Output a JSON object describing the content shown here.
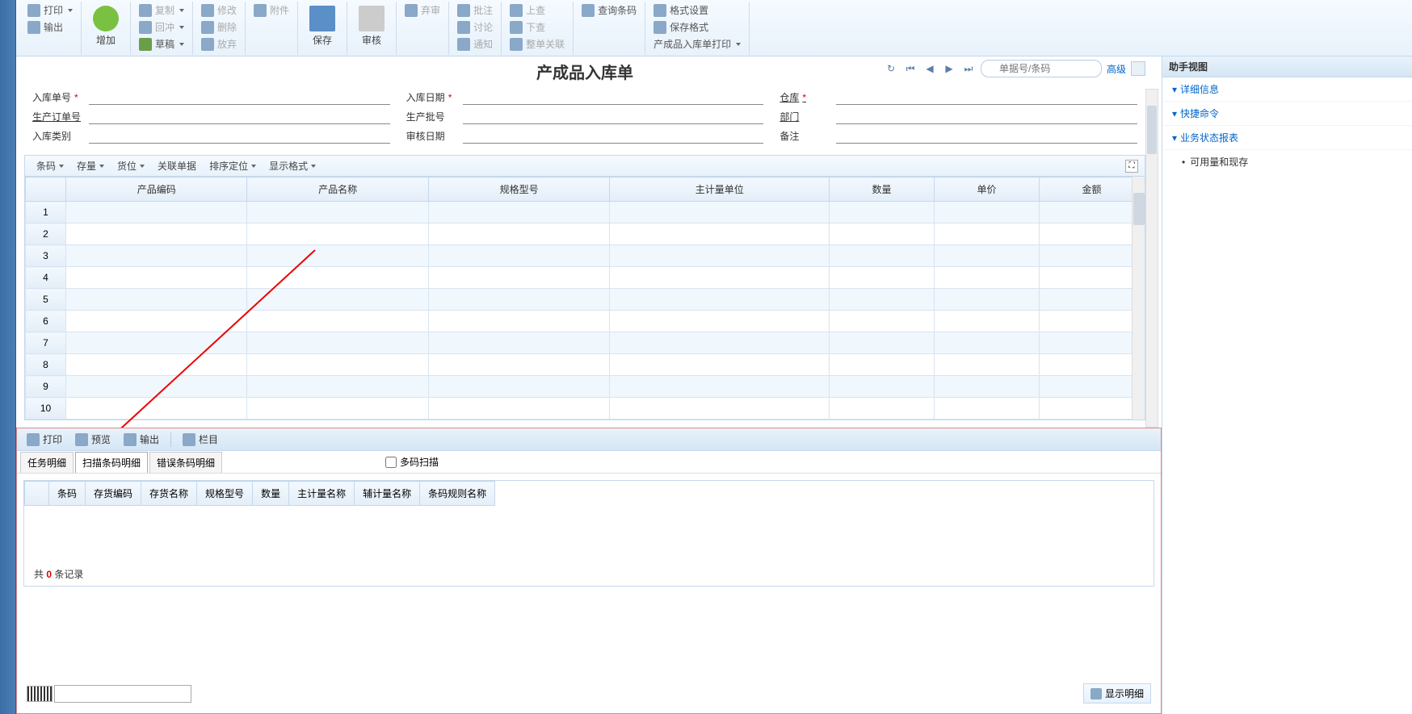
{
  "ribbon": {
    "print": "打印",
    "export": "输出",
    "add": "增加",
    "copy": "复制",
    "undo": "回冲",
    "draft": "草稿",
    "modify": "修改",
    "delete": "删除",
    "attach": "附件",
    "abandon": "放弃",
    "save": "保存",
    "audit": "审核",
    "reject": "弃审",
    "approve": "批注",
    "discuss": "讨论",
    "notify": "通知",
    "submit": "上查",
    "lookup": "下查",
    "wholeLink": "整单关联",
    "queryBarcode": "查询条码",
    "formatSet": "格式设置",
    "saveFormat": "保存格式",
    "printDoc": "产成品入库单打印"
  },
  "doc": {
    "title": "产成品入库单",
    "searchPlaceholder": "单据号/条码",
    "advanced": "高级"
  },
  "form": {
    "billNo": "入库单号",
    "billDate": "入库日期",
    "warehouse": "仓库",
    "prodOrder": "生产订单号",
    "prodBatch": "生产批号",
    "dept": "部门",
    "inType": "入库类别",
    "auditDate": "审核日期",
    "memo": "备注"
  },
  "gridToolbar": {
    "barcode": "条码",
    "stock": "存量",
    "loc": "货位",
    "related": "关联单据",
    "sort": "排序定位",
    "display": "显示格式"
  },
  "gridCols": [
    "产品编码",
    "产品名称",
    "规格型号",
    "主计量单位",
    "数量",
    "单价",
    "金额"
  ],
  "gridRows": [
    1,
    2,
    3,
    4,
    5,
    6,
    7,
    8,
    9,
    10
  ],
  "bottom": {
    "print": "打印",
    "preview": "预览",
    "export": "输出",
    "columns": "栏目",
    "tab1": "任务明细",
    "tab2": "扫描条码明细",
    "tab3": "错误条码明细",
    "multiScan": "多码扫描",
    "cols": [
      "条码",
      "存货编码",
      "存货名称",
      "规格型号",
      "数量",
      "主计量名称",
      "辅计量名称",
      "条码规则名称"
    ],
    "summaryPrefix": "共",
    "summaryCount": "0",
    "summarySuffix": "条记录",
    "showDetail": "显示明细"
  },
  "assist": {
    "title": "助手视图",
    "detail": "详细信息",
    "quick": "快捷命令",
    "report": "业务状态报表",
    "sub1": "可用量和现存"
  }
}
